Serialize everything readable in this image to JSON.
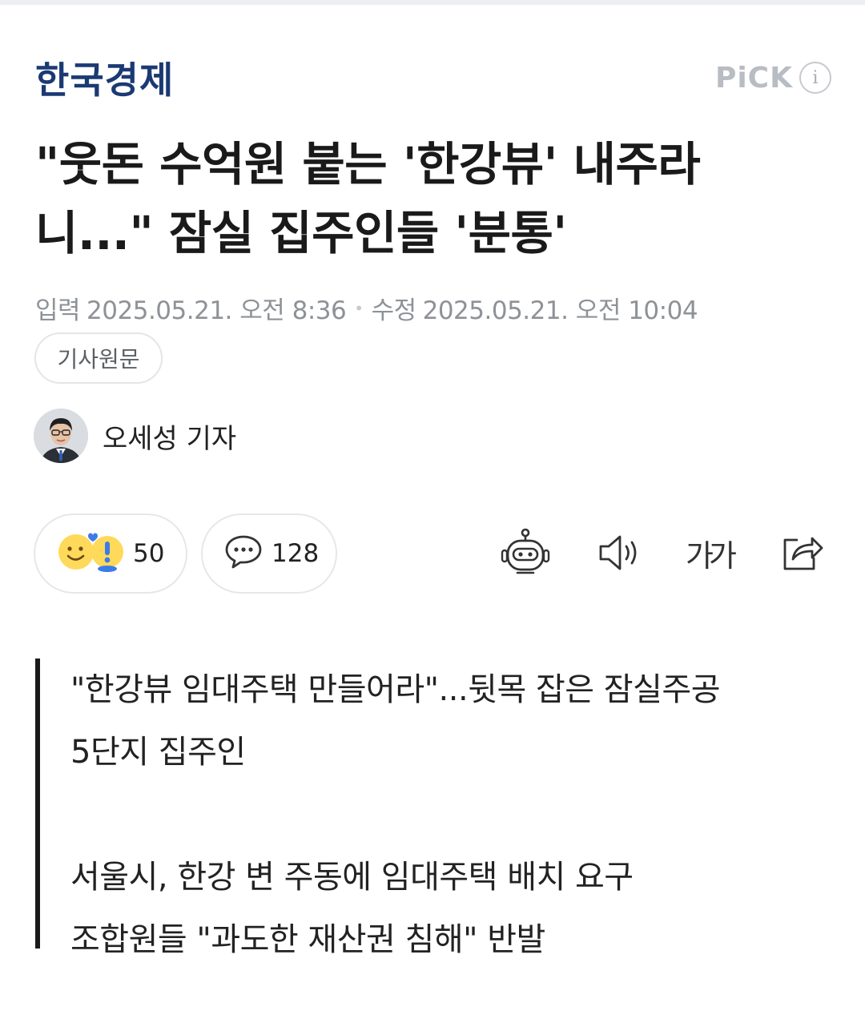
{
  "header": {
    "logo": "한국경제",
    "pick_label": "PiCK",
    "info_icon": "info-icon"
  },
  "article": {
    "title_line1": "\"웃돈 수억원 붙는 '한강뷰' 내주라",
    "title_line2": "니...\" 잠실 집주인들 '분통'",
    "published_label": "입력",
    "published": "2025.05.21. 오전 8:36",
    "modified_label": "수정",
    "modified": "2025.05.21. 오전 10:04",
    "source_button": "기사원문",
    "reporter": "오세성 기자"
  },
  "actions": {
    "reaction_count": "50",
    "comment_count": "128",
    "font_size_label": "가가",
    "icons": [
      "robot-summary-icon",
      "speaker-icon",
      "font-size-icon",
      "share-icon"
    ]
  },
  "summary": {
    "lines": [
      "\"한강뷰 임대주택 만들어라\"...뒷목 잡은 잠실주공",
      "5단지 집주인",
      "서울시, 한강 변 주동에 임대주택 배치 요구",
      "조합원들 \"과도한 재산권 침해\" 반발"
    ]
  },
  "colors": {
    "logo": "#1b3a73",
    "muted": "#8e9297",
    "border": "#e5e7ea"
  }
}
